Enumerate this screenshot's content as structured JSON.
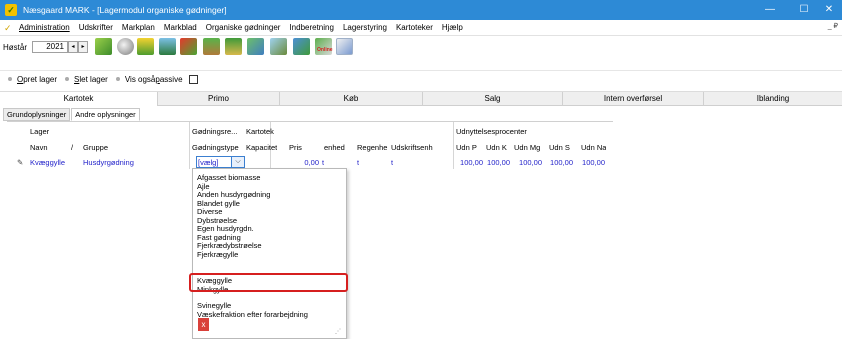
{
  "window": {
    "title": "Næsgaard MARK - [Lagermodul organiske gødninger]",
    "minimize": "—",
    "maximize": "☐",
    "close": "✕"
  },
  "menu": {
    "items": [
      "Administration",
      "Udskrifter",
      "Markplan",
      "Markblad",
      "Organiske gødninger",
      "Indberetning",
      "Lagerstyring",
      "Kartoteker",
      "Hjælp"
    ],
    "mdi_controls": "_ ₽"
  },
  "toolbar": {
    "year_label": "Høstår",
    "year_value": "2021",
    "spin_left": "◂",
    "spin_right": "▸",
    "online_label": "Online"
  },
  "actions": {
    "create_prefix": "O",
    "create_rest": "pret lager",
    "delete_prefix": "S",
    "delete_rest": "let lager",
    "show_prefix": "Vis også ",
    "show_underline": "p",
    "show_rest": "assive"
  },
  "tabs": [
    "Kartotek",
    "Primo",
    "Køb",
    "Salg",
    "Intern overførsel",
    "Iblanding"
  ],
  "subtabs": [
    "Grundoplysninger",
    "Andre oplysninger"
  ],
  "grid": {
    "group_headers": {
      "lager": "Lager",
      "gdn": "Gødningsre...",
      "kartotek": "Kartotek",
      "udnyt": "Udnyttelsesprocenter"
    },
    "columns": [
      "Navn",
      "Gruppe",
      "Gødningstype",
      "Kapacitet",
      "Pris",
      "enhed",
      "Regenhe",
      "Udskriftsenh",
      "Udn P",
      "Udn K",
      "Udn Mg",
      "Udn S",
      "Udn Na"
    ],
    "sort_marker": "/",
    "row": {
      "marker": "✎",
      "navn": "Kvæggylle",
      "gruppe": "Husdyrgødning",
      "type": "[vælg]",
      "pris": "0,00",
      "enhed": "t",
      "regenhed": "t",
      "udskrift": "t",
      "udn_p": "100,00",
      "udn_k": "100,00",
      "udn_mg": "100,00",
      "udn_s": "100,00",
      "udn_na": "100,00"
    }
  },
  "dropdown": {
    "items": [
      "Afgasset biomasse",
      "Ajle",
      "Anden husdyrgødning",
      "Blandet gylle",
      "Diverse",
      "Dybstrøelse",
      "Egen husdyrgdn.",
      "Fast gødning",
      "Fjerkrædybstrøelse",
      "Fjerkrægylle",
      "Kvæggylle",
      "Minkgylle",
      "Svinegylle",
      "Væskefraktion efter forarbejdning"
    ],
    "selected": "Kvæggylle",
    "close": "x",
    "grip": "⋰"
  },
  "colors": {
    "titlebar": "#2d8ad6",
    "highlight": "#d61f1f",
    "value_text": "#1f1fc9"
  }
}
